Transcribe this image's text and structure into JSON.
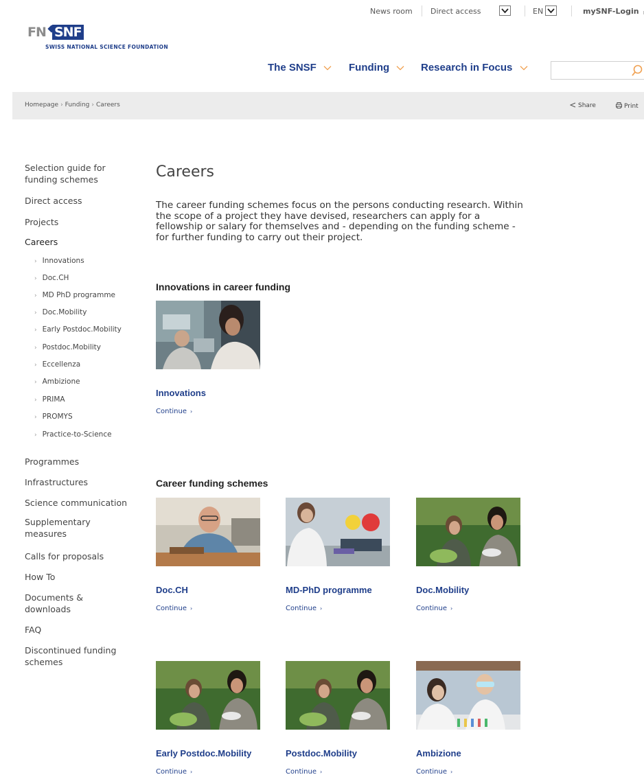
{
  "topbar": {
    "news_room": "News room",
    "direct_access": "Direct access",
    "language": "EN",
    "login": "mySNF-Login"
  },
  "logo": {
    "fn": "FN",
    "snf": "SNF",
    "name": "Swiss National Science Foundation"
  },
  "nav": {
    "items": [
      "The SNSF",
      "Funding",
      "Research in Focus"
    ]
  },
  "breadcrumb": {
    "items": [
      "Homepage",
      "Funding",
      "Careers"
    ],
    "share": "Share",
    "print": "Print"
  },
  "sidebar": {
    "items": [
      "Selection guide for funding schemes",
      "Direct access",
      "Projects",
      "Careers",
      "Programmes",
      "Infrastructures",
      "Science communication",
      "Supplementary measures",
      "Calls for proposals",
      "How To",
      "Documents & downloads",
      "FAQ",
      "Discontinued funding schemes"
    ],
    "careers_sub": [
      "Innovations",
      "Doc.CH",
      "MD PhD programme",
      "Doc.Mobility",
      "Early Postdoc.Mobility",
      "Postdoc.Mobility",
      "Eccellenza",
      "Ambizione",
      "PRIMA",
      "PROMYS",
      "Practice-to-Science"
    ]
  },
  "content": {
    "title": "Careers",
    "intro": "The career funding schemes focus on the persons conducting research. Within the scope of a project they have devised, researchers can apply for a fellowship or salary for themselves and - depending on the funding scheme - for further funding to carry out their project.",
    "section1_title": "Innovations in career funding",
    "section2_title": "Career funding schemes",
    "continue_label": "Continue",
    "cards": [
      {
        "title": "Innovations"
      },
      {
        "title": "Doc.CH"
      },
      {
        "title": "MD-PhD programme"
      },
      {
        "title": "Doc.Mobility"
      },
      {
        "title": "Early Postdoc.Mobility"
      },
      {
        "title": "Postdoc.Mobility"
      },
      {
        "title": "Ambizione"
      }
    ]
  },
  "colors": {
    "brand_blue": "#1f3e8a",
    "accent_orange": "#f0a050",
    "breadcrumb_bg": "#ececec"
  }
}
